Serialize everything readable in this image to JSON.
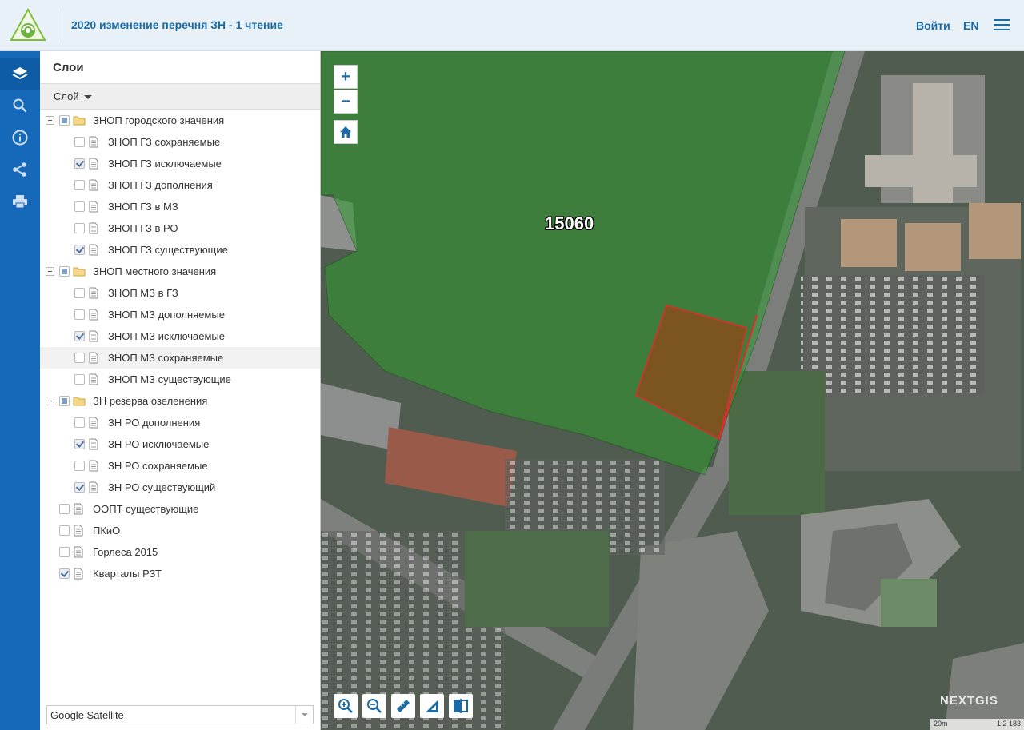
{
  "header": {
    "title": "2020 изменение перечня ЗН - 1 чтение",
    "login": "Войти",
    "lang": "EN"
  },
  "panel": {
    "title": "Слои",
    "dropdown_label": "Слой",
    "basemap": "Google Satellite"
  },
  "tree": {
    "g1": {
      "label": "ЗНОП городского значения",
      "state": "partial"
    },
    "g1_items": [
      {
        "label": "ЗНОП ГЗ сохраняемые",
        "checked": false
      },
      {
        "label": "ЗНОП ГЗ исключаемые",
        "checked": true
      },
      {
        "label": "ЗНОП ГЗ дополнения",
        "checked": false
      },
      {
        "label": "ЗНОП ГЗ в МЗ",
        "checked": false
      },
      {
        "label": "ЗНОП ГЗ в РО",
        "checked": false
      },
      {
        "label": "ЗНОП ГЗ существующие",
        "checked": true
      }
    ],
    "g2": {
      "label": "ЗНОП местного значения",
      "state": "partial"
    },
    "g2_items": [
      {
        "label": "ЗНОП МЗ в ГЗ",
        "checked": false
      },
      {
        "label": "ЗНОП МЗ дополняемые",
        "checked": false
      },
      {
        "label": "ЗНОП МЗ исключаемые",
        "checked": true
      },
      {
        "label": "ЗНОП МЗ сохраняемые",
        "checked": false
      },
      {
        "label": "ЗНОП МЗ существующие",
        "checked": false
      }
    ],
    "g3": {
      "label": "ЗН резерва озеленения",
      "state": "partial"
    },
    "g3_items": [
      {
        "label": "ЗН РО дополнения",
        "checked": false
      },
      {
        "label": "ЗН РО исключаемые",
        "checked": true
      },
      {
        "label": "ЗН РО сохраняемые",
        "checked": false
      },
      {
        "label": "ЗН РО существующий",
        "checked": true
      }
    ],
    "top_items": [
      {
        "label": "ООПТ существующие",
        "checked": false
      },
      {
        "label": "ПКиО",
        "checked": false
      },
      {
        "label": "Горлеса 2015",
        "checked": false
      },
      {
        "label": "Кварталы РЗТ",
        "checked": true
      }
    ]
  },
  "map": {
    "parcel_label": "15060",
    "attribution": "NEXTGIS",
    "scale_left": "20m",
    "scale_right": "1:2 183",
    "colors": {
      "green_zone": "#2e9a2e",
      "excluded_parcel": "#8b4a1a",
      "parcel_border": "#e8282a"
    }
  },
  "icons": {
    "rail": [
      "layers-icon",
      "search-icon",
      "info-icon",
      "share-icon",
      "print-icon"
    ],
    "map_tools": [
      "zoom-in-box-icon",
      "zoom-out-box-icon",
      "ruler-icon",
      "area-measure-icon",
      "swipe-icon"
    ]
  }
}
